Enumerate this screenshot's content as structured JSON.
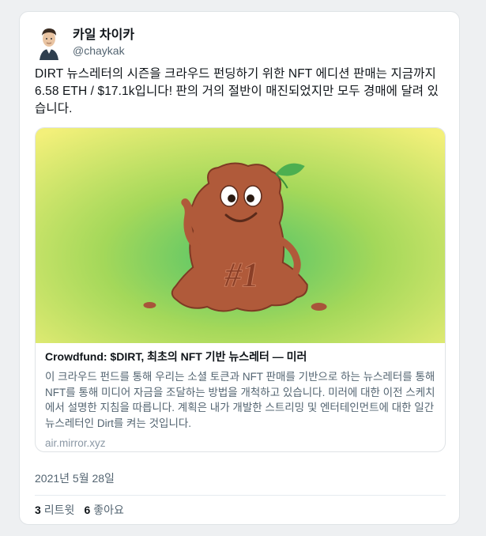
{
  "tweet": {
    "display_name": "카일 차이카",
    "handle": "@chaykak",
    "text": "DIRT 뉴스레터의 시즌을 크라우드 펀딩하기 위한 NFT 에디션 판매는 지금까지 6.58 ETH / $17.1k입니다! 판의 거의 절반이 매진되었지만 모두 경매에 달려 있습니다.",
    "date": "2021년 5월 28일",
    "retweets_count": "3",
    "retweets_label": "리트윗",
    "likes_count": "6",
    "likes_label": "좋아요"
  },
  "link_card": {
    "title": "Crowdfund: $DIRT, 최초의 NFT 기반 뉴스레터 — 미러",
    "description": "이 크라우드 펀드를 통해 우리는 소셜 토큰과 NFT 판매를 기반으로 하는 뉴스레터를 통해 NFT를 통해 미디어 자금을 조달하는 방법을 개척하고 있습니다. 미러에 대한 이전 스케치에서 설명한 지침을 따릅니다. 계획은 내가 개발한 스트리밍 및 엔터테인먼트에 대한 일간 뉴스레터인 Dirt를 켜는 것입니다.",
    "domain": "air.mirror.xyz",
    "image_text": "#1"
  },
  "colors": {
    "text_primary": "#0f1419",
    "text_secondary": "#536471",
    "dirt_brown": "#b05a3a",
    "leaf_green": "#4caf50"
  }
}
